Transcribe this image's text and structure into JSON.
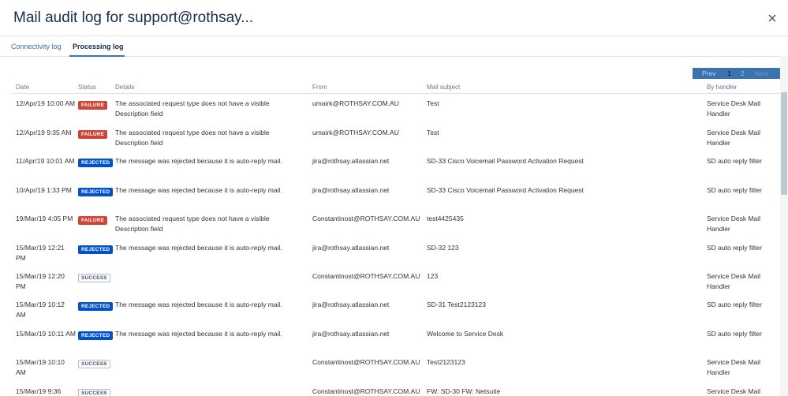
{
  "dialog": {
    "title": "Mail audit log for support@rothsay..."
  },
  "tabs": [
    {
      "label": "Connectivity log",
      "active": false
    },
    {
      "label": "Processing log",
      "active": true
    }
  ],
  "pager": {
    "prev": "Prev",
    "pages": [
      "1",
      "2"
    ],
    "current": "1",
    "next": "Next"
  },
  "table": {
    "headers": {
      "date": "Date",
      "status": "Status",
      "details": "Details",
      "from": "From",
      "subject": "Mail subject",
      "handler": "By handler"
    },
    "rows": [
      {
        "date": "12/Apr/19 10:00 AM",
        "status": "FAILURE",
        "status_type": "failure",
        "details": "The associated request type does not have a visible Description field",
        "from": "umairk@ROTHSAY.COM.AU",
        "subject": "Test",
        "handler": "Service Desk Mail Handler"
      },
      {
        "date": "12/Apr/19 9:35 AM",
        "status": "FAILURE",
        "status_type": "failure",
        "details": "The associated request type does not have a visible Description field",
        "from": "umairk@ROTHSAY.COM.AU",
        "subject": "Test",
        "handler": "Service Desk Mail Handler"
      },
      {
        "date": "11/Apr/19 10:01 AM",
        "status": "REJECTED",
        "status_type": "rejected",
        "details": "The message was rejected because it is auto-reply mail.",
        "from": "jira@rothsay.atlassian.net",
        "subject": "SD-33 Cisco Voicemail Password Activation Request",
        "handler": "SD auto reply filter"
      },
      {
        "date": "10/Apr/19 1:33 PM",
        "status": "REJECTED",
        "status_type": "rejected",
        "details": "The message was rejected because it is auto-reply mail.",
        "from": "jira@rothsay.atlassian.net",
        "subject": "SD-33 Cisco Voicemail Password Activation Request",
        "handler": "SD auto reply filter"
      },
      {
        "date": "19/Mar/19 4:05 PM",
        "status": "FAILURE",
        "status_type": "failure",
        "details": "The associated request type does not have a visible Description field",
        "from": "Constantinost@ROTHSAY.COM.AU",
        "subject": "test4425435",
        "handler": "Service Desk Mail Handler"
      },
      {
        "date": "15/Mar/19 12:21 PM",
        "status": "REJECTED",
        "status_type": "rejected",
        "details": "The message was rejected because it is auto-reply mail.",
        "from": "jira@rothsay.atlassian.net",
        "subject": "SD-32 123",
        "handler": "SD auto reply filter"
      },
      {
        "date": "15/Mar/19 12:20 PM",
        "status": "SUCCESS",
        "status_type": "success",
        "details": "",
        "from": "Constantinost@ROTHSAY.COM.AU",
        "subject": "123",
        "handler": "Service Desk Mail Handler"
      },
      {
        "date": "15/Mar/19 10:12 AM",
        "status": "REJECTED",
        "status_type": "rejected",
        "details": "The message was rejected because it is auto-reply mail.",
        "from": "jira@rothsay.atlassian.net",
        "subject": "SD-31 Test2123123",
        "handler": "SD auto reply filter"
      },
      {
        "date": "15/Mar/19 10:11 AM",
        "status": "REJECTED",
        "status_type": "rejected",
        "details": "The message was rejected because it is auto-reply mail.",
        "from": "jira@rothsay.atlassian.net",
        "subject": "Welcome to Service Desk",
        "handler": "SD auto reply filter"
      },
      {
        "date": "15/Mar/19 10:10 AM",
        "status": "SUCCESS",
        "status_type": "success",
        "details": "",
        "from": "Constantinost@ROTHSAY.COM.AU",
        "subject": "Test2123123",
        "handler": "Service Desk Mail Handler"
      },
      {
        "date": "15/Mar/19 9:36",
        "status": "SUCCESS",
        "status_type": "success",
        "details": "",
        "from": "Constantinost@ROTHSAY.COM.AU",
        "subject": "FW: SD-30 FW: Netsuite",
        "handler": "Service Desk Mail"
      }
    ]
  },
  "icons": {
    "close": "close-icon"
  },
  "colors": {
    "accent": "#3b73af",
    "failure": "#d04437",
    "rejected": "#0052cc",
    "success_border": "#b3bac5"
  }
}
